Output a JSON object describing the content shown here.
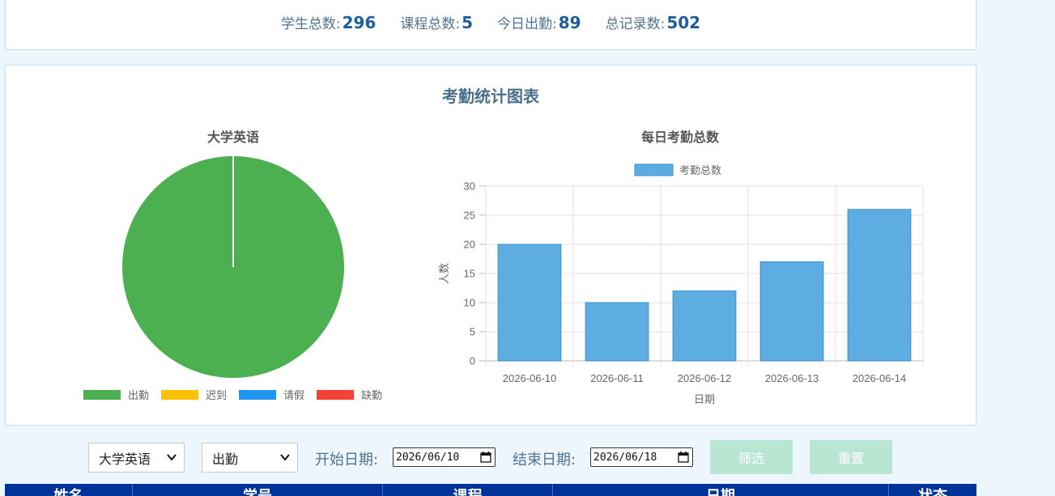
{
  "stats": [
    {
      "label": "学生总数:",
      "value": "296"
    },
    {
      "label": "课程总数:",
      "value": "5"
    },
    {
      "label": "今日出勤:",
      "value": "89"
    },
    {
      "label": "总记录数:",
      "value": "502"
    }
  ],
  "panel_title": "考勤统计图表",
  "chart_data": [
    {
      "type": "pie",
      "title": "大学英语",
      "categories": [
        "出勤",
        "迟到",
        "请假",
        "缺勤"
      ],
      "values": [
        100,
        0,
        0,
        0
      ],
      "colors": [
        "#4caf50",
        "#ffc107",
        "#2196f3",
        "#f44336"
      ],
      "legend_position": "bottom"
    },
    {
      "type": "bar",
      "title": "每日考勤总数",
      "categories": [
        "2026-06-10",
        "2026-06-11",
        "2026-06-12",
        "2026-06-13",
        "2026-06-14"
      ],
      "series": [
        {
          "name": "考勤总数",
          "values": [
            20,
            10,
            12,
            17,
            26
          ],
          "color": "#5dade2"
        }
      ],
      "xlabel": "日期",
      "ylabel": "人数",
      "ylim": [
        0,
        30
      ],
      "yticks": [
        0,
        5,
        10,
        15,
        20,
        25,
        30
      ],
      "grid": true,
      "legend_position": "top"
    }
  ],
  "filters": {
    "course": "大学英语",
    "status": "出勤",
    "start_label": "开始日期:",
    "start_value": "2026/06/10",
    "end_label": "结束日期:",
    "end_value": "2026/06/18",
    "filter_button": "筛选",
    "reset_button": "重置"
  },
  "table": {
    "headers": [
      "姓名",
      "学号",
      "课程",
      "日期",
      "状态"
    ]
  },
  "icons": {
    "dropdown": "chevron-down-icon",
    "date_picker": "calendar-icon"
  }
}
